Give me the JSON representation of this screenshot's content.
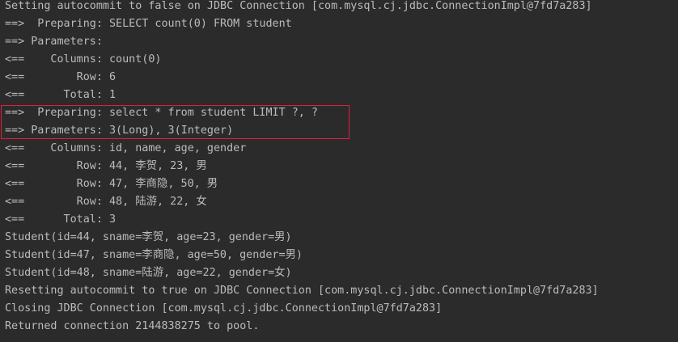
{
  "console": {
    "lines": [
      "Setting autocommit to false on JDBC Connection [com.mysql.cj.jdbc.ConnectionImpl@7fd7a283]",
      "==>  Preparing: SELECT count(0) FROM student",
      "==> Parameters: ",
      "<==    Columns: count(0)",
      "<==        Row: 6",
      "<==      Total: 1",
      "==>  Preparing: select * from student LIMIT ?, ?",
      "==> Parameters: 3(Long), 3(Integer)",
      "<==    Columns: id, name, age, gender",
      "<==        Row: 44, 李贺, 23, 男",
      "<==        Row: 47, 李商隐, 50, 男",
      "<==        Row: 48, 陆游, 22, 女",
      "<==      Total: 3",
      "Student(id=44, sname=李贺, age=23, gender=男)",
      "Student(id=47, sname=李商隐, age=50, gender=男)",
      "Student(id=48, sname=陆游, age=22, gender=女)",
      "Resetting autocommit to true on JDBC Connection [com.mysql.cj.jdbc.ConnectionImpl@7fd7a283]",
      "Closing JDBC Connection [com.mysql.cj.jdbc.ConnectionImpl@7fd7a283]",
      "Returned connection 2144838275 to pool."
    ]
  },
  "colors": {
    "background": "#2b2b2b",
    "text": "#bbbbbb",
    "highlight_border": "#e0203a"
  }
}
